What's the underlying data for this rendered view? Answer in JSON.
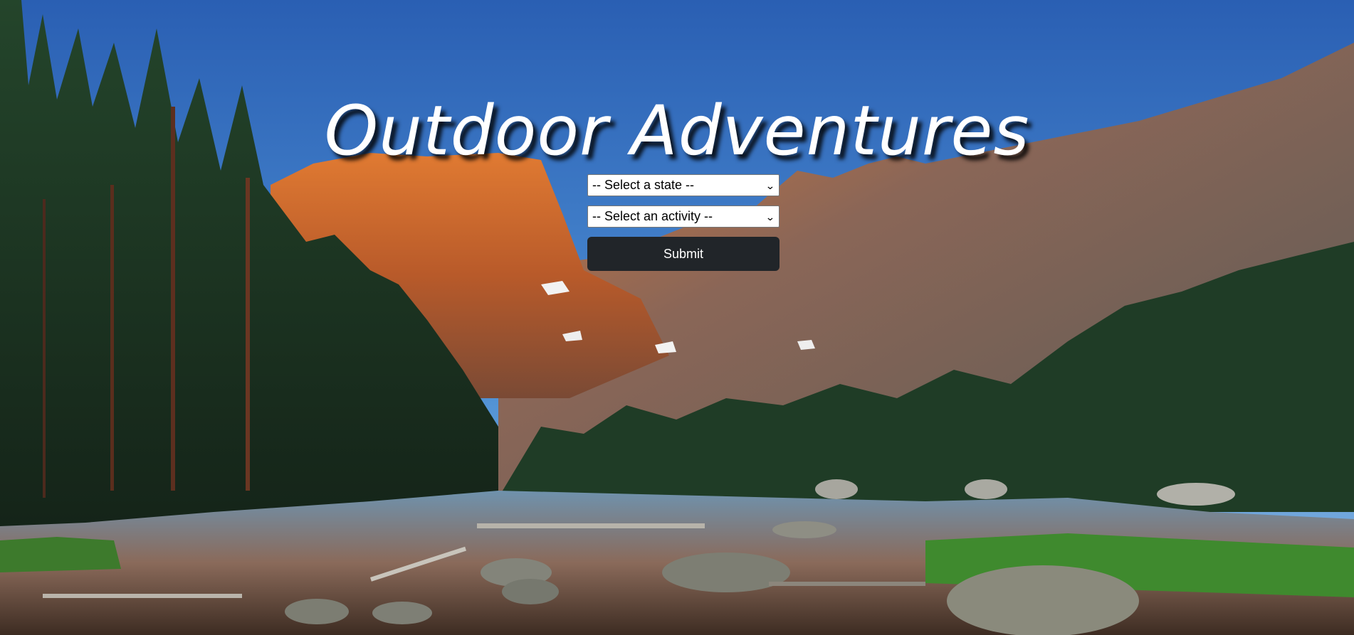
{
  "header": {
    "title": "Outdoor Adventures"
  },
  "form": {
    "state_select": {
      "selected": "-- Select a state --"
    },
    "activity_select": {
      "selected": "-- Select an activity --"
    },
    "submit_label": "Submit"
  },
  "background": {
    "description_icon": "mountain-lake-landscape",
    "colors": {
      "sky_top": "#2d63b7",
      "sky_bottom": "#7fb2e0",
      "cliff": "#c8652b",
      "forest": "#1f3b25",
      "lake": "#5a7f9a"
    }
  },
  "colors": {
    "button_bg": "#212529",
    "button_text": "#ffffff",
    "title_text": "#ffffff"
  }
}
